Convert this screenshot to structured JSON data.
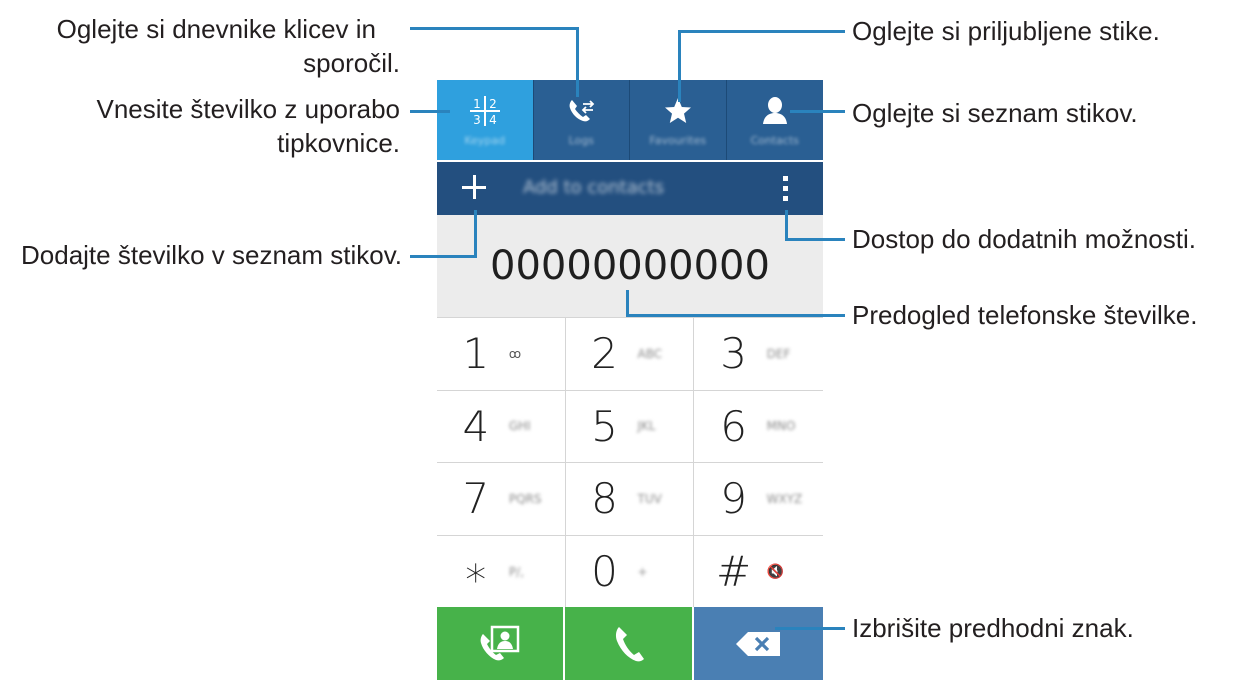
{
  "phone": {
    "tabs": [
      {
        "name": "Keypad",
        "icon": "keypad-icon",
        "active": true
      },
      {
        "name": "Logs",
        "icon": "logs-icon",
        "active": false
      },
      {
        "name": "Favourites",
        "icon": "star-icon",
        "active": false
      },
      {
        "name": "Contacts",
        "icon": "person-icon",
        "active": false
      }
    ],
    "action_bar": {
      "label": "Add to contacts"
    },
    "number": "00000000000",
    "keys": [
      {
        "digit": "1",
        "sub": "ꝏ"
      },
      {
        "digit": "2",
        "sub": "ABC"
      },
      {
        "digit": "3",
        "sub": "DEF"
      },
      {
        "digit": "4",
        "sub": "GHI"
      },
      {
        "digit": "5",
        "sub": "JKL"
      },
      {
        "digit": "6",
        "sub": "MNO"
      },
      {
        "digit": "7",
        "sub": "PQRS"
      },
      {
        "digit": "8",
        "sub": "TUV"
      },
      {
        "digit": "9",
        "sub": "WXYZ"
      },
      {
        "digit": "∗",
        "sub": "P/,"
      },
      {
        "digit": "0",
        "sub": "+"
      },
      {
        "digit": "#",
        "sub": "🔇"
      }
    ],
    "colors": {
      "tab_bar": "#2a5f93",
      "active_tab": "#2fa0de",
      "call_green": "#47b24a",
      "delete_blue": "#4a7fb3",
      "leader_line": "#2a83bd"
    }
  },
  "annotations": {
    "logs_line1": "Oglejte si dnevnike klicev in",
    "logs_line2": "sporočil.",
    "keypad_line1": "Vnesite številko z uporabo",
    "keypad_line2": "tipkovnice.",
    "add_contact": "Dodajte številko v seznam stikov.",
    "favourites": "Oglejte si priljubljene stike.",
    "contacts": "Oglejte si seznam stikov.",
    "options": "Dostop do dodatnih možnosti.",
    "preview": "Predogled telefonske številke.",
    "delete": "Izbrišite predhodni znak."
  }
}
